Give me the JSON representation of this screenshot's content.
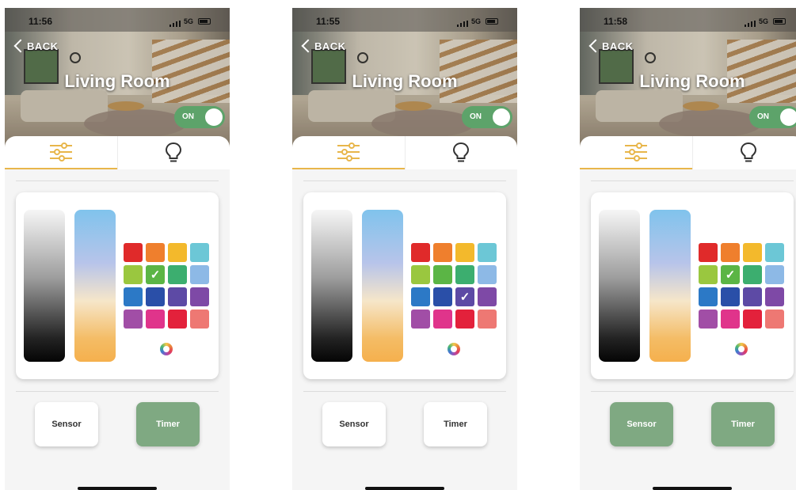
{
  "colors": {
    "accent": "#e8b64b",
    "toggle_on": "#5da36a",
    "button_active": "#7fa982",
    "palette": [
      "#e02a2a",
      "#ef7f2d",
      "#f3b92c",
      "#6cc7d6",
      "#9ac73f",
      "#5bb545",
      "#3cae6f",
      "#8db9e6",
      "#2c79c6",
      "#2a4fa8",
      "#5d4aa5",
      "#7e49a6",
      "#a14ea6",
      "#e0348b",
      "#e3213b",
      "#ee7873"
    ]
  },
  "screens": [
    {
      "status_time": "11:56",
      "network": "5G",
      "back_label": "BACK",
      "title": "Living Room",
      "toggle_label": "ON",
      "tabs": [
        {
          "icon": "sliders-icon"
        },
        {
          "icon": "bulb-icon"
        }
      ],
      "selected_swatch": 5,
      "buttons": {
        "sensor": "Sensor",
        "timer": "Timer"
      },
      "sensor_active": false,
      "timer_active": true
    },
    {
      "status_time": "11:55",
      "network": "5G",
      "back_label": "BACK",
      "title": "Living Room",
      "toggle_label": "ON",
      "tabs": [
        {
          "icon": "sliders-icon"
        },
        {
          "icon": "bulb-icon"
        }
      ],
      "selected_swatch": 10,
      "buttons": {
        "sensor": "Sensor",
        "timer": "Timer"
      },
      "sensor_active": false,
      "timer_active": false
    },
    {
      "status_time": "11:58",
      "network": "5G",
      "back_label": "BACK",
      "title": "Living Room",
      "toggle_label": "ON",
      "tabs": [
        {
          "icon": "sliders-icon"
        },
        {
          "icon": "bulb-icon"
        }
      ],
      "selected_swatch": 5,
      "buttons": {
        "sensor": "Sensor",
        "timer": "Timer"
      },
      "sensor_active": true,
      "timer_active": true
    }
  ]
}
